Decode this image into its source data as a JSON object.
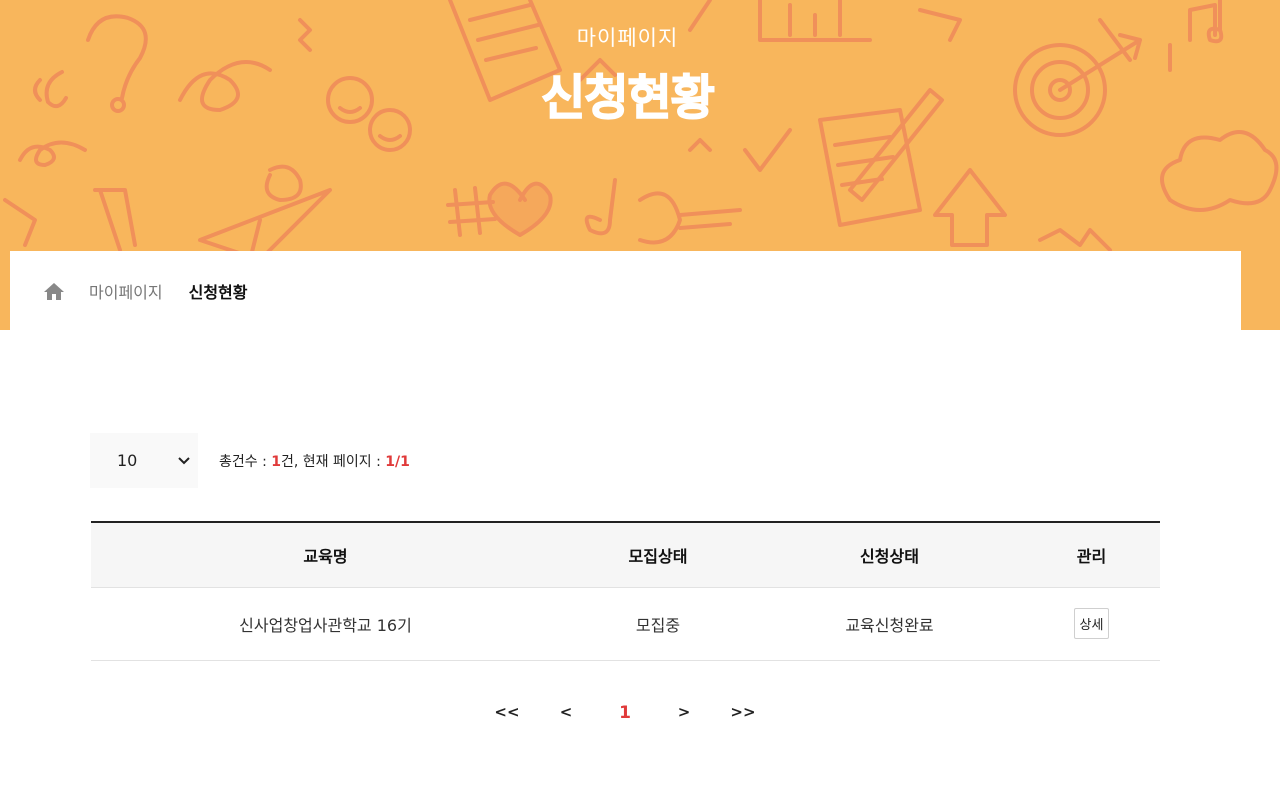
{
  "hero": {
    "subtitle": "마이페이지",
    "title": "신청현황",
    "background_color": "#f8b65c"
  },
  "breadcrumb": {
    "home_icon": "home-icon",
    "items": [
      "마이페이지",
      "신청현황"
    ]
  },
  "list_controls": {
    "page_size": "10",
    "count_prefix": "총건수 : ",
    "count_value": "1",
    "count_suffix": "건, 현재 페이지 : ",
    "page_value": "1/1"
  },
  "table": {
    "headers": [
      "교육명",
      "모집상태",
      "신청상태",
      "관리"
    ],
    "rows": [
      {
        "course": "신사업창업사관학교 16기",
        "recruit_status": "모집중",
        "apply_status": "교육신청완료",
        "action": "상세"
      }
    ]
  },
  "pagination": {
    "first": "<<",
    "prev": "<",
    "current": "1",
    "next": ">",
    "last": ">>"
  },
  "colors": {
    "accent_red": "#e03a3a",
    "doodle": "#ef8a5a"
  }
}
